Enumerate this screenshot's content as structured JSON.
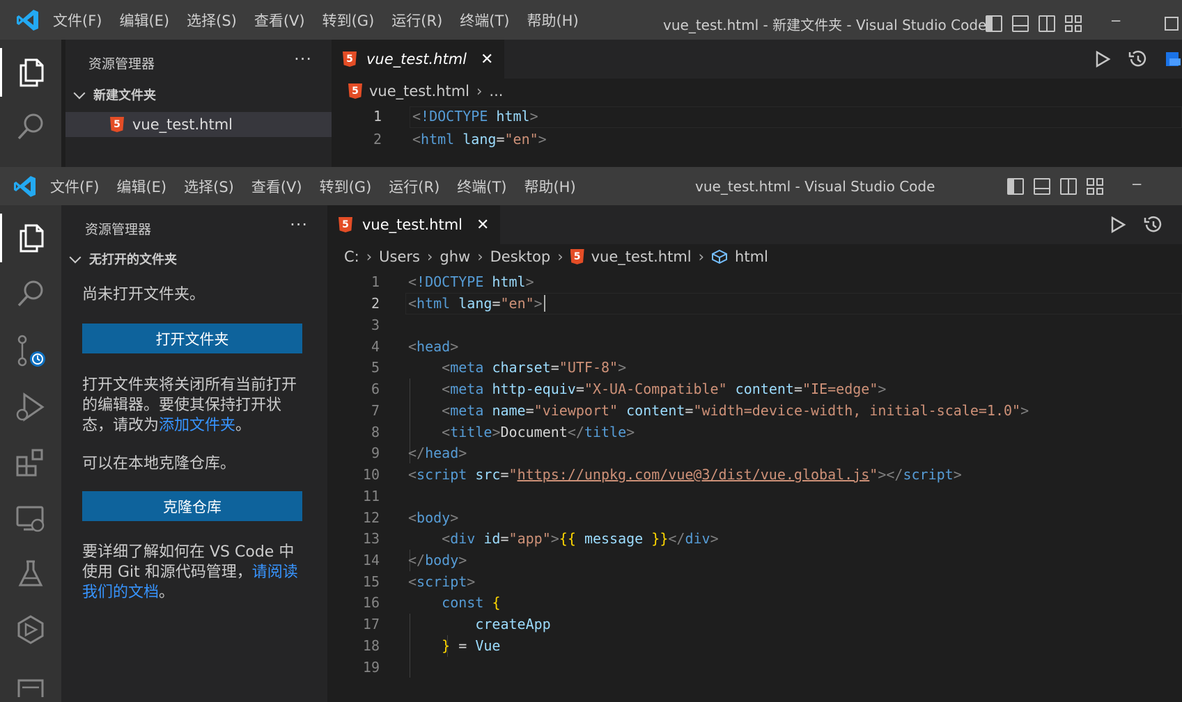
{
  "menu": [
    "文件(F)",
    "编辑(E)",
    "选择(S)",
    "查看(V)",
    "转到(G)",
    "运行(R)",
    "终端(T)",
    "帮助(H)"
  ],
  "back": {
    "title": "vue_test.html - 新建文件夹 - Visual Studio Code",
    "sidebar_title": "资源管理器",
    "sidebar_more": "···",
    "folder": "新建文件夹",
    "file": "vue_test.html",
    "tab": "vue_test.html",
    "crumb_file": "vue_test.html",
    "crumb_more": "...",
    "lines": [
      {
        "n": "1",
        "c": "<!DOCTYPE html>"
      },
      {
        "n": "2",
        "c": "<html lang=\"en\">"
      }
    ],
    "file_icon_letter": "5",
    "close_glyph": "✕",
    "minimize_glyph": "─"
  },
  "front": {
    "title": "vue_test.html - Visual Studio Code",
    "sidebar_title": "资源管理器",
    "sidebar_more": "···",
    "section": "无打开的文件夹",
    "no_folder": "尚未打开文件夹。",
    "open_folder_btn": "打开文件夹",
    "open_desc": "打开文件夹将关闭所有当前打开的编辑器。要使其保持打开状态，请改为",
    "open_desc_link": "添加文件夹",
    "open_desc_end": "。",
    "clone_desc": "可以在本地克隆仓库。",
    "clone_btn": "克隆仓库",
    "learn_desc": "要详细了解如何在 VS Code 中使用 Git 和源代码管理，",
    "learn_link": "请阅读我们的文档",
    "learn_end": "。",
    "tab": "vue_test.html",
    "breadcrumb": [
      "C:",
      "Users",
      "ghw",
      "Desktop",
      "vue_test.html",
      "html"
    ],
    "line_numbers": [
      "1",
      "2",
      "3",
      "4",
      "5",
      "6",
      "7",
      "8",
      "9",
      "10",
      "11",
      "12",
      "13",
      "14",
      "15",
      "16",
      "17",
      "18",
      "19"
    ],
    "file_icon_letter": "5",
    "close_glyph": "✕",
    "minimize_glyph": "─",
    "code_colors": {
      "tag": "#569cd6",
      "attr": "#9cdcfe",
      "string": "#ce9178",
      "bracket": "#ffd700"
    }
  },
  "activity_icons": [
    "explorer-icon",
    "search-icon",
    "source-control-icon",
    "run-debug-icon",
    "extensions-icon",
    "remote-explorer-icon",
    "testing-icon",
    "vue-icon",
    "output-icon"
  ]
}
